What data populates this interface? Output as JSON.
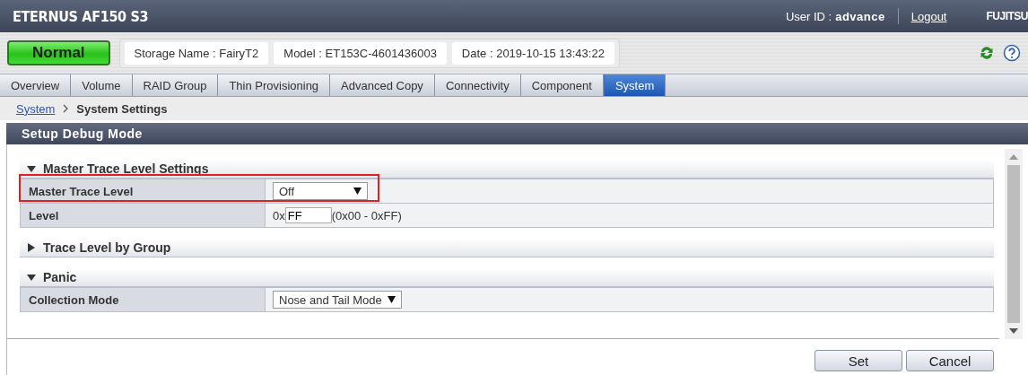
{
  "header": {
    "product": "ETERNUS AF150 S3",
    "user_label": "User ID :",
    "user": "advance",
    "logout": "Logout",
    "logo": "FUJITSU"
  },
  "status_bar": {
    "status": "Normal",
    "fields": [
      "Storage Name : FairyT2",
      "Model : ET153C-4601436003",
      "Date : 2019-10-15 13:43:22"
    ]
  },
  "tabs": [
    {
      "label": "Overview",
      "selected": false
    },
    {
      "label": "Volume",
      "selected": false
    },
    {
      "label": "RAID Group",
      "selected": false
    },
    {
      "label": "Thin Provisioning",
      "selected": false
    },
    {
      "label": "Advanced Copy",
      "selected": false
    },
    {
      "label": "Connectivity",
      "selected": false
    },
    {
      "label": "Component",
      "selected": false
    },
    {
      "label": "System",
      "selected": true
    }
  ],
  "breadcrumb": {
    "link": "System",
    "current": "System Settings"
  },
  "panel": {
    "title": "Setup Debug Mode",
    "sections": [
      {
        "title": "Master Trace Level Settings",
        "expanded": true,
        "rows": [
          {
            "label": "Master Trace Level",
            "kind": "select",
            "value": "Off",
            "highlighted": true
          },
          {
            "label": "Level",
            "kind": "hex",
            "prefix": "0x",
            "value": "FF",
            "hint": "(0x00 - 0xFF)",
            "highlighted": false
          }
        ]
      },
      {
        "title": "Trace Level by Group",
        "expanded": false
      },
      {
        "title": "Panic",
        "expanded": true,
        "rows": [
          {
            "label": "Collection Mode",
            "kind": "select",
            "value": "Nose and Tail Mode",
            "highlighted": false
          }
        ]
      }
    ]
  },
  "buttons": [
    "Set",
    "Cancel"
  ]
}
